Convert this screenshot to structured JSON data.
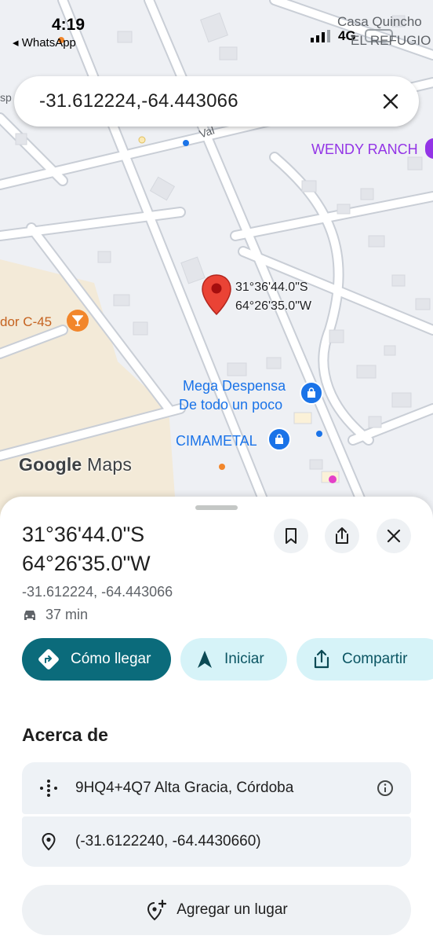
{
  "status_bar": {
    "time": "4:19",
    "back_app": "◂ WhatsApp",
    "network": "4G"
  },
  "search": {
    "query": "-31.612224,-64.443066"
  },
  "map": {
    "labels": {
      "casa_quincho": "Casa Quincho",
      "el_refugio": "EL REFUGIO",
      "wendy_ranch": "WENDY RANCH",
      "mega_despensa_1": "Mega Despensa",
      "mega_despensa_2": "De todo un poco",
      "cimametal": "CIMAMETAL",
      "mirador": "dor C-45",
      "road": "Val",
      "left_edge": "sp"
    },
    "pin": {
      "lat_label": "31°36'44.0\"S",
      "lng_label": "64°26'35.0\"W"
    },
    "logo_google": "Google",
    "logo_maps": "Maps"
  },
  "place": {
    "title_line1": "31°36'44.0\"S",
    "title_line2": "64°26'35.0\"W",
    "decimal_coords": "-31.612224, -64.443066",
    "drive_time": "37 min",
    "actions": {
      "directions": "Cómo llegar",
      "start": "Iniciar",
      "share": "Compartir"
    },
    "about_title": "Acerca de",
    "plus_code": "9HQ4+4Q7 Alta Gracia, Córdoba",
    "precise_coords": "(-31.6122240, -64.4430660)",
    "add_place": "Agregar un lugar"
  },
  "colors": {
    "primary_chip": "#0b6b7b",
    "secondary_chip": "#d6f3f8",
    "pin_red": "#ea4335",
    "poi_blue": "#1a73e8"
  },
  "icons": [
    "bookmark-icon",
    "share-icon",
    "close-icon",
    "car-icon",
    "directions-icon",
    "navigation-icon",
    "plus-code-icon",
    "info-icon",
    "location-pin-icon",
    "add-location-icon"
  ]
}
